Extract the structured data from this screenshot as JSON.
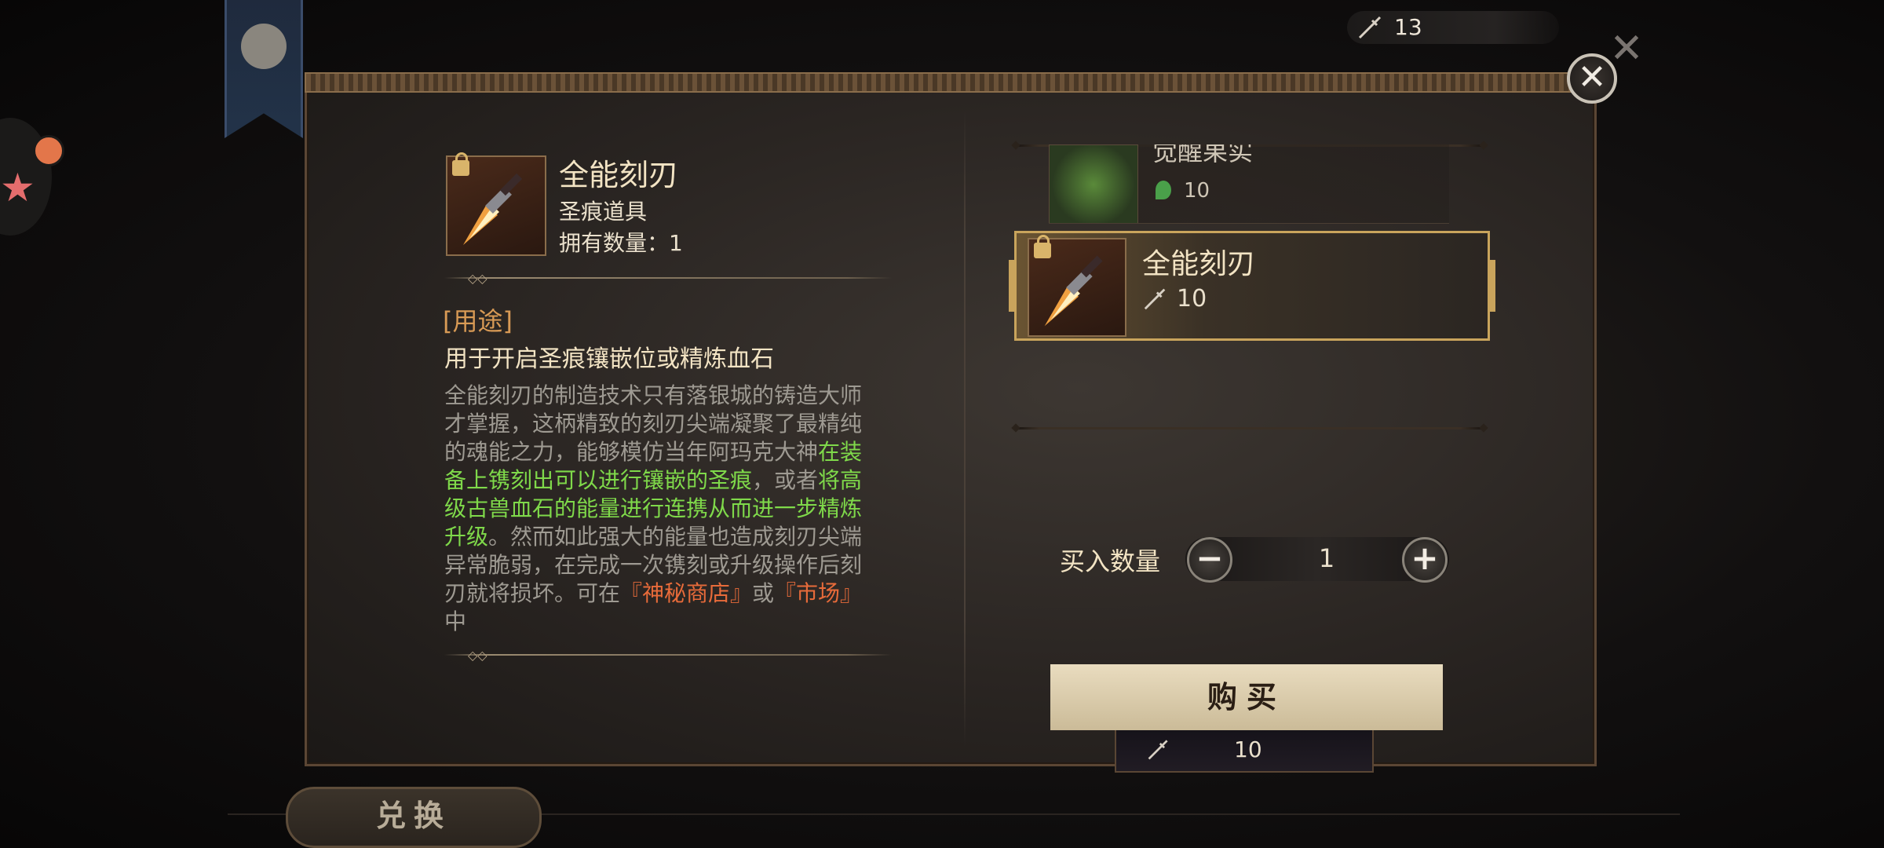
{
  "top_bar": {
    "currency_value": "13",
    "currency_icon": "dagger-icon"
  },
  "item": {
    "name": "全能刻刃",
    "type": "圣痕道具",
    "owned": "拥有数量：1",
    "use_tag": "[用途]",
    "use_text": "用于开启圣痕镶嵌位或精炼血石",
    "description": {
      "p1": "全能刻刃的制造技术只有落银城的铸造大师才掌握，这柄精致的刻刃尖端凝聚了最精纯的魂能之力，能够模仿当年阿玛克大神",
      "g1": "在装备上镌刻出可以进行镶嵌的圣痕",
      "p2": "，或者",
      "g2": "将高级古兽血石的能量进行连携从而进一步精炼升级",
      "p3": "。然而如此强大的能量也造成刻刃尖端异常脆弱，在完成一次镌刻或升级操作后刻刃就将损坏。可在",
      "o1": "『神秘商店』",
      "p4": "或",
      "o2": "『市场』",
      "p5": "中"
    }
  },
  "shop_list": [
    {
      "name": "觉醒果实",
      "price": "10",
      "price_icon": "leaf-icon"
    },
    {
      "name": "全能刻刃",
      "price": "10",
      "price_icon": "dagger-icon",
      "selected": true
    }
  ],
  "quantity": {
    "label": "买入数量",
    "value": "1",
    "minus": "−",
    "plus": "+"
  },
  "buy": {
    "label": "购买",
    "cost": "10"
  },
  "exchange_label": "兑换",
  "close_symbol": "✕",
  "colors": {
    "highlight_green": "#7fd94a",
    "highlight_orange": "#e86b3a",
    "gold_border": "#c9a45c"
  }
}
